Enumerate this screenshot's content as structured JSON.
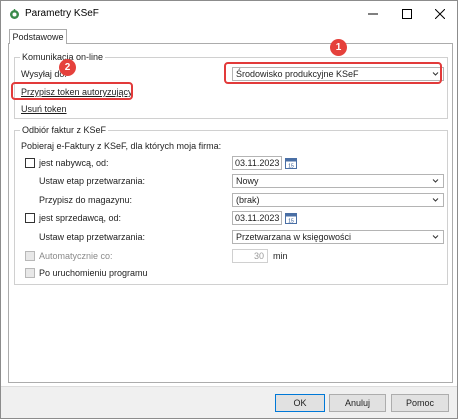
{
  "window": {
    "title": "Parametry KSeF"
  },
  "tabs": [
    {
      "label": "Podstawowe",
      "active": true
    }
  ],
  "online_group": {
    "legend": "Komunikacja on-line",
    "send_to_label": "Wysyłaj do:",
    "send_to_value": "Środowisko produkcyjne KSeF",
    "assign_token_link": "Przypisz token autoryzujący",
    "remove_token_link": "Usuń token"
  },
  "receive_group": {
    "legend": "Odbiór faktur z KSeF",
    "intro": "Pobieraj e-Faktury z KSeF, dla których moja firma:",
    "buyer_checkbox_label": "jest nabywcą, od:",
    "buyer_date": "03.11.2023",
    "buyer_stage_label": "Ustaw etap przetwarzania:",
    "buyer_stage_value": "Nowy",
    "warehouse_label": "Przypisz do magazynu:",
    "warehouse_value": "(brak)",
    "seller_checkbox_label": "jest sprzedawcą, od:",
    "seller_date": "03.11.2023",
    "seller_stage_label": "Ustaw etap przetwarzania:",
    "seller_stage_value": "Przetwarzana w księgowości",
    "auto_label": "Automatycznie co:",
    "auto_value": "30",
    "auto_unit": "min",
    "startup_label": "Po uruchomieniu programu"
  },
  "callouts": [
    {
      "number": "1"
    },
    {
      "number": "2"
    }
  ],
  "buttons": {
    "ok": "OK",
    "cancel": "Anuluj",
    "help": "Pomoc"
  },
  "colors": {
    "callout": "#e5413c",
    "highlight": "#e23a3a",
    "accent": "#0078d7"
  }
}
